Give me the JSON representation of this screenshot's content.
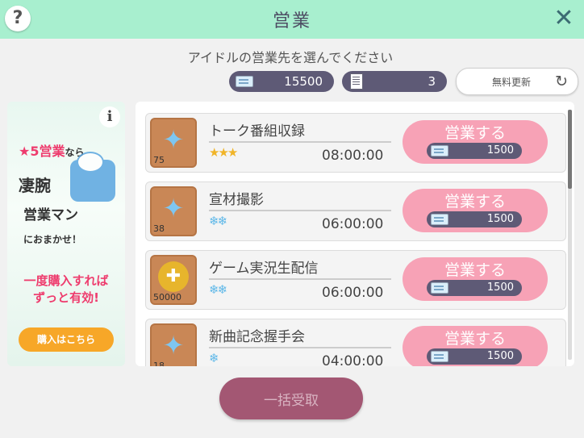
{
  "header": {
    "title": "営業",
    "help_icon": "?",
    "close_icon": "✕"
  },
  "subtitle": "アイドルの営業先を選んでください",
  "resources": {
    "tickets": "15500",
    "papers": "3"
  },
  "refresh": {
    "label": "無料更新",
    "icon": "↻"
  },
  "banner": {
    "info": "i",
    "line1_star": "★5営業",
    "line1_suffix": "なら",
    "line2": "凄腕",
    "line3": "営業マン",
    "line4": "におまかせ！",
    "line5": "一度購入すれば",
    "line6": "ずっと有効!",
    "buy_label": "購入はこちら"
  },
  "jobs": [
    {
      "title": "トーク番組収録",
      "difficulty": "★★★",
      "time": "08:00:00",
      "count": "75",
      "icon": "✦",
      "action": "営業する",
      "cost": "1500"
    },
    {
      "title": "宣材撮影",
      "difficulty": "❄❄",
      "time": "06:00:00",
      "count": "38",
      "icon": "✦",
      "action": "営業する",
      "cost": "1500"
    },
    {
      "title": "ゲーム実況生配信",
      "difficulty": "❄❄",
      "time": "06:00:00",
      "count": "50000",
      "icon": "✚",
      "action": "営業する",
      "cost": "1500"
    },
    {
      "title": "新曲記念握手会",
      "difficulty": "❄",
      "time": "04:00:00",
      "count": "18",
      "icon": "✦",
      "action": "営業する",
      "cost": "1500"
    }
  ],
  "collect_all": "一括受取",
  "colors": {
    "header": "#a8efcf",
    "action": "#f7a2b6",
    "pill": "#5e5a76",
    "accent_pink": "#ee3b6d",
    "buy": "#f7a728",
    "collect": "#a35773"
  }
}
